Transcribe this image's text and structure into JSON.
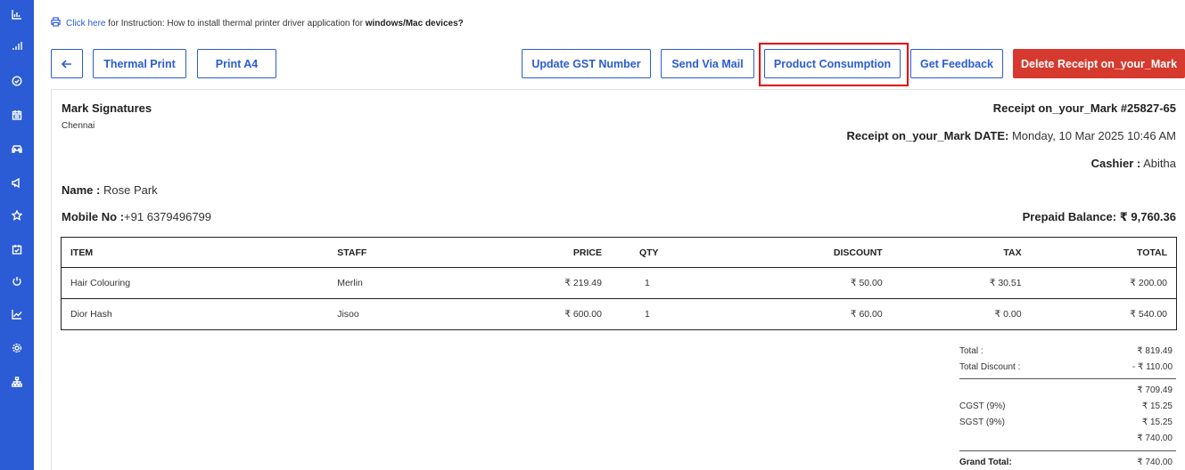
{
  "sidebar": {
    "icons": [
      "bar-chart-icon",
      "signal-icon",
      "check-circle-icon",
      "calendar-icon",
      "car-icon",
      "megaphone-icon",
      "star-icon",
      "calendar-check-icon",
      "power-icon",
      "trend-icon",
      "settings-icon",
      "sitemap-icon"
    ]
  },
  "instruction": {
    "link": "Click here",
    "text": "for Instruction: How to install thermal printer driver application for",
    "bold": "windows/Mac devices?"
  },
  "toolbar": {
    "thermal_print": "Thermal Print",
    "print_a4": "Print A4",
    "update_gst": "Update GST Number",
    "send_mail": "Send Via Mail",
    "product_consumption": "Product Consumption",
    "get_feedback": "Get Feedback",
    "delete_receipt": "Delete Receipt on_your_Mark"
  },
  "receipt": {
    "shop_name": "Mark Signatures",
    "shop_city": "Chennai",
    "number": "Receipt on_your_Mark #25827-65",
    "date_label": "Receipt on_your_Mark DATE:",
    "date_value": "Monday, 10 Mar 2025 10:46 AM",
    "cashier_label": "Cashier :",
    "cashier_value": "Abitha",
    "name_label": "Name :",
    "name_value": "Rose Park",
    "mobile_label": "Mobile No :",
    "mobile_value": "+91 6379496799",
    "prepaid_label": "Prepaid Balance:",
    "prepaid_value": "₹ 9,760.36"
  },
  "table": {
    "headers": [
      "ITEM",
      "STAFF",
      "PRICE",
      "QTY",
      "DISCOUNT",
      "TAX",
      "TOTAL"
    ],
    "rows": [
      [
        "Hair Colouring",
        "Merlin",
        "₹ 219.49",
        "1",
        "₹ 50.00",
        "₹ 30.51",
        "₹ 200.00"
      ],
      [
        "Dior Hash",
        "Jisoo",
        "₹ 600.00",
        "1",
        "₹ 60.00",
        "₹ 0.00",
        "₹ 540.00"
      ]
    ]
  },
  "totals": {
    "total_label": "Total :",
    "total_value": "₹ 819.49",
    "discount_label": "Total Discount :",
    "discount_value": "- ₹ 110.00",
    "subtotal_value": "₹ 709.49",
    "cgst_label": "CGST (9%)",
    "cgst_value": "₹ 15.25",
    "sgst_label": "SGST (9%)",
    "sgst_value": "₹ 15.25",
    "after_tax_value": "₹ 740.00",
    "grand_label": "Grand Total:",
    "grand_value": "₹ 740.00"
  }
}
